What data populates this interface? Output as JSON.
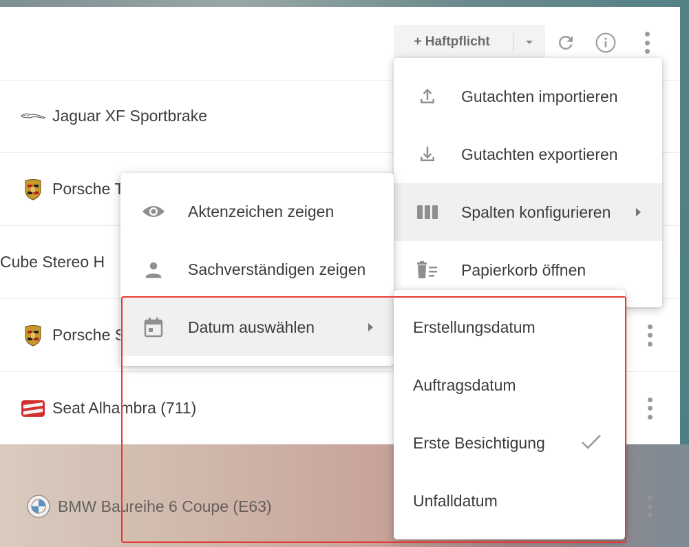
{
  "toolbar": {
    "add_button_label": "+ Haftpflicht",
    "dropdown_icon": "caret-down-icon",
    "refresh_icon": "refresh-icon",
    "info_icon": "info-icon",
    "more_icon": "more-vertical-icon"
  },
  "rows": [
    {
      "label": "Jaguar XF Sportbrake",
      "logo": "jaguar-logo"
    },
    {
      "label": "Porsche T",
      "logo": "porsche-logo"
    },
    {
      "label": "Cube Stereo H",
      "logo": ""
    },
    {
      "label": "Porsche S",
      "logo": "porsche-logo"
    },
    {
      "label": "Seat Alhambra (711)",
      "logo": "seat-logo"
    },
    {
      "label": "BMW Baureihe 6 Coupe (E63)",
      "logo": "bmw-logo"
    }
  ],
  "main_menu": {
    "items": [
      {
        "label": "Gutachten importieren",
        "icon": "upload-icon"
      },
      {
        "label": "Gutachten exportieren",
        "icon": "download-icon"
      },
      {
        "label": "Spalten konfigurieren",
        "icon": "columns-icon",
        "has_submenu": true,
        "highlighted": true
      },
      {
        "label": "Papierkorb öffnen",
        "icon": "trash-list-icon"
      }
    ]
  },
  "columns_submenu": {
    "items": [
      {
        "label": "Aktenzeichen zeigen",
        "icon": "eye-icon"
      },
      {
        "label": "Sachverständigen zeigen",
        "icon": "person-icon"
      },
      {
        "label": "Datum auswählen",
        "icon": "calendar-icon",
        "has_submenu": true,
        "highlighted": true
      }
    ]
  },
  "date_submenu": {
    "items": [
      {
        "label": "Erstellungsdatum",
        "checked": false
      },
      {
        "label": "Auftragsdatum",
        "checked": false
      },
      {
        "label": "Erste Besichtigung",
        "checked": true
      },
      {
        "label": "Unfalldatum",
        "checked": false
      }
    ]
  },
  "colors": {
    "highlight_border": "#e53935",
    "icon_gray": "#9a9a9a",
    "menu_hover": "#f0f0f0"
  }
}
